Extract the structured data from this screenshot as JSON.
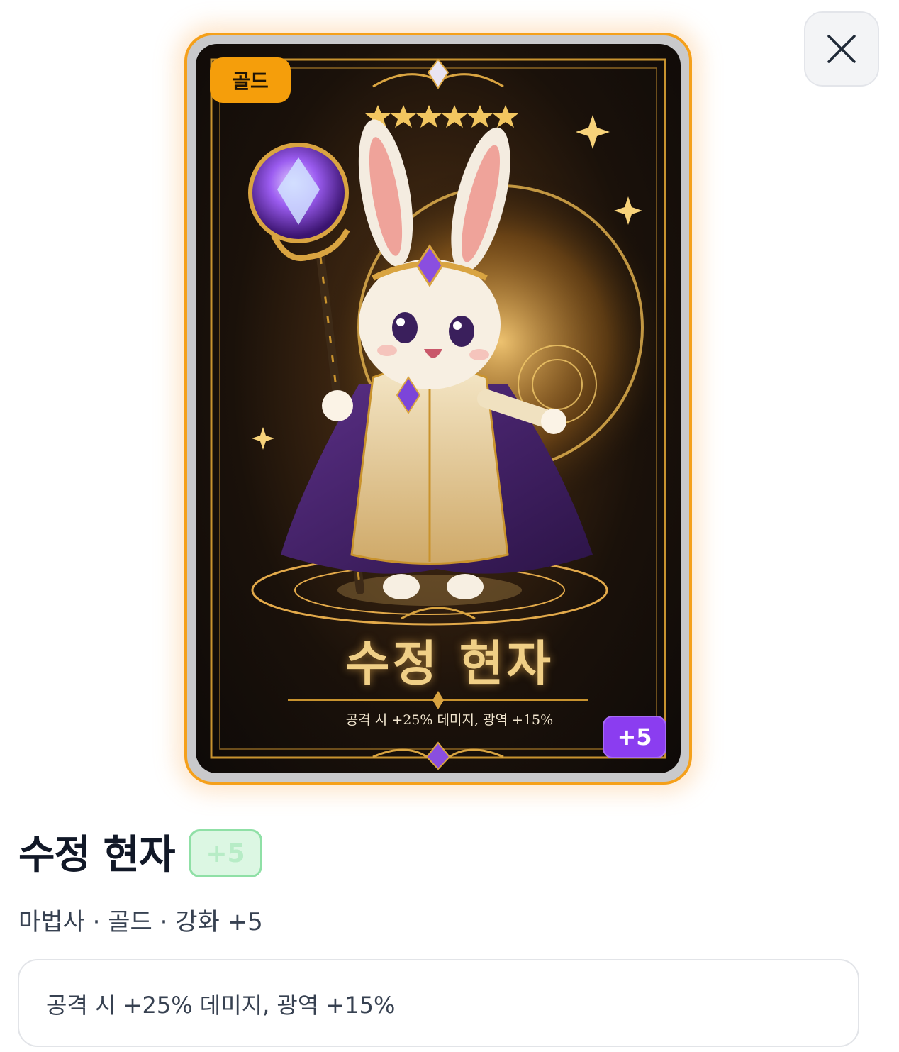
{
  "card": {
    "rarity": "골드",
    "title": "수정 현자",
    "description": "공격 시 +25% 데미지, 광역 +15%",
    "level_badge": "+5",
    "stars": 6
  },
  "detail": {
    "name": "수정 현자",
    "level_badge": "+5",
    "meta": "마법사 · 골드 · 강화 +5",
    "description": "공격 시 +25% 데미지, 광역 +15%"
  },
  "colors": {
    "gold_border": "#f5a01a",
    "rarity_badge": "#f59e0b",
    "level_badge": "#8b3df0",
    "level_pill_bg": "#dcf7e3",
    "level_pill_border": "#8fe0a6"
  }
}
